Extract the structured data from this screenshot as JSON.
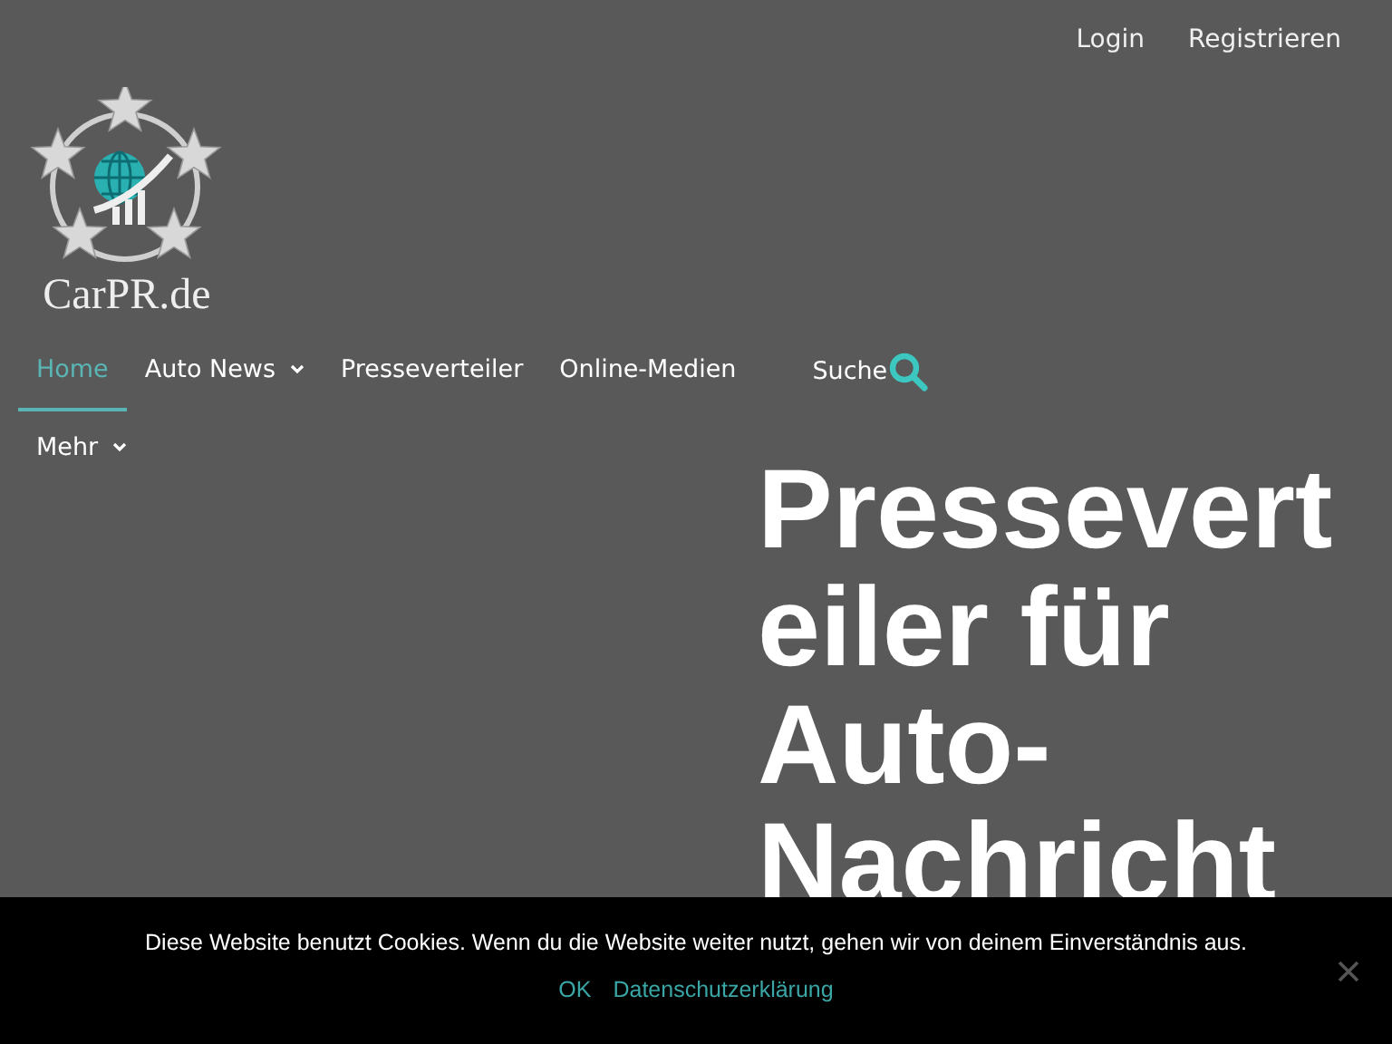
{
  "header_links": [
    {
      "label": "Login"
    },
    {
      "label": "Registrieren"
    }
  ],
  "logo": {
    "text": "CarPR.de"
  },
  "nav": [
    {
      "label": "Home",
      "selected": true,
      "dropdown": false
    },
    {
      "label": "Auto News",
      "selected": false,
      "dropdown": true
    },
    {
      "label": "Presseverteiler",
      "selected": false,
      "dropdown": false
    },
    {
      "label": "Online-Medien",
      "selected": false,
      "dropdown": false
    }
  ],
  "search": {
    "label": "Suche"
  },
  "more_menu": {
    "label": "Mehr",
    "dropdown": true
  },
  "heading": "Presseverteiler für Auto-Nachricht",
  "cookie_notice": {
    "text": "Diese Website benutzt Cookies. Wenn du die Website weiter nutzt, gehen wir von deinem Einverständnis aus.",
    "ok": "OK",
    "privacy_link": "Datenschutzerklärung"
  }
}
